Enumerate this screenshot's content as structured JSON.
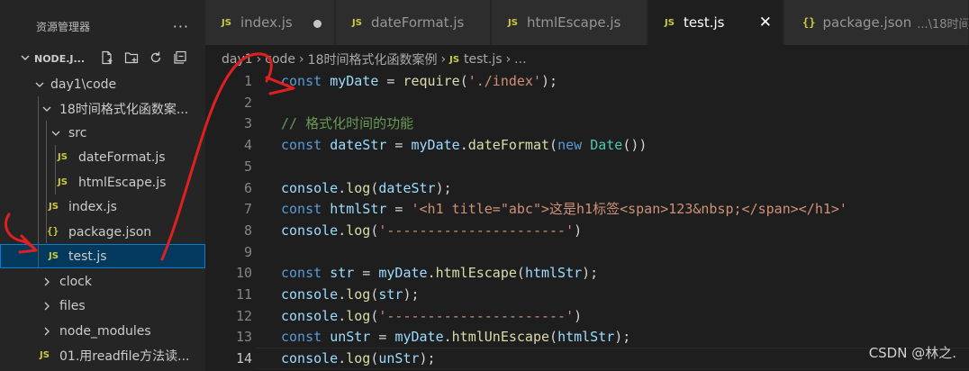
{
  "sidebar": {
    "header_title": "资源管理器",
    "more_label": "···",
    "section_title": "NODE.J...",
    "tree": [
      {
        "label": "day1\\code",
        "type": "folder-open"
      },
      {
        "label": "18时间格式化函数案...",
        "type": "folder-open"
      },
      {
        "label": "src",
        "type": "folder-open"
      },
      {
        "label": "dateFormat.js",
        "type": "js"
      },
      {
        "label": "htmlEscape.js",
        "type": "js"
      },
      {
        "label": "index.js",
        "type": "js"
      },
      {
        "label": "package.json",
        "type": "json"
      },
      {
        "label": "test.js",
        "type": "js",
        "selected": true
      },
      {
        "label": "clock",
        "type": "folder-closed"
      },
      {
        "label": "files",
        "type": "folder-closed"
      },
      {
        "label": "node_modules",
        "type": "folder-closed"
      },
      {
        "label": "01.用readfile方法读...",
        "type": "js"
      }
    ]
  },
  "tabs": [
    {
      "icon": "JS",
      "label": "index.js",
      "state": "modified"
    },
    {
      "icon": "JS",
      "label": "dateFormat.js",
      "state": ""
    },
    {
      "icon": "JS",
      "label": "htmlEscape.js",
      "state": ""
    },
    {
      "icon": "JS",
      "label": "test.js",
      "state": "active"
    },
    {
      "icon": "{}",
      "label": "package.json",
      "desc": "...\\18时间"
    }
  ],
  "tab_close_glyph": "✕",
  "breadcrumb": {
    "parts": [
      "day1",
      "code",
      "18时间格式化函数案例",
      "test.js",
      "..."
    ],
    "file_icon": "JS"
  },
  "editor": {
    "current_line": 14,
    "lines": [
      {
        "n": "1",
        "tokens": [
          [
            "kw",
            "const"
          ],
          [
            "pun",
            " "
          ],
          [
            "var",
            "myDate"
          ],
          [
            "pun",
            " = "
          ],
          [
            "fn",
            "require"
          ],
          [
            "pun",
            "("
          ],
          [
            "str",
            "'./index'"
          ],
          [
            "pun",
            ");"
          ]
        ]
      },
      {
        "n": "2",
        "tokens": []
      },
      {
        "n": "3",
        "tokens": [
          [
            "cmt",
            "// 格式化时间的功能"
          ]
        ]
      },
      {
        "n": "4",
        "tokens": [
          [
            "kw",
            "const"
          ],
          [
            "pun",
            " "
          ],
          [
            "var",
            "dateStr"
          ],
          [
            "pun",
            " = "
          ],
          [
            "var",
            "myDate"
          ],
          [
            "pun",
            "."
          ],
          [
            "fn",
            "dateFormat"
          ],
          [
            "pun",
            "("
          ],
          [
            "kw",
            "new"
          ],
          [
            "pun",
            " "
          ],
          [
            "cls",
            "Date"
          ],
          [
            "pun",
            "())"
          ]
        ]
      },
      {
        "n": "5",
        "tokens": []
      },
      {
        "n": "6",
        "tokens": [
          [
            "var",
            "console"
          ],
          [
            "pun",
            "."
          ],
          [
            "fn",
            "log"
          ],
          [
            "pun",
            "("
          ],
          [
            "var",
            "dateStr"
          ],
          [
            "pun",
            ");"
          ]
        ]
      },
      {
        "n": "7",
        "tokens": [
          [
            "kw",
            "const"
          ],
          [
            "pun",
            " "
          ],
          [
            "var",
            "htmlStr"
          ],
          [
            "pun",
            " = "
          ],
          [
            "str",
            "'<h1 title=\"abc\">这是h1标签<span>123&nbsp;</span></h1>'"
          ]
        ]
      },
      {
        "n": "8",
        "tokens": [
          [
            "var",
            "console"
          ],
          [
            "pun",
            "."
          ],
          [
            "fn",
            "log"
          ],
          [
            "pun",
            "("
          ],
          [
            "str",
            "'----------------------'"
          ],
          [
            "pun",
            ")"
          ]
        ]
      },
      {
        "n": "9",
        "tokens": []
      },
      {
        "n": "10",
        "tokens": [
          [
            "kw",
            "const"
          ],
          [
            "pun",
            " "
          ],
          [
            "var",
            "str"
          ],
          [
            "pun",
            " = "
          ],
          [
            "var",
            "myDate"
          ],
          [
            "pun",
            "."
          ],
          [
            "fn",
            "htmlEscape"
          ],
          [
            "pun",
            "("
          ],
          [
            "var",
            "htmlStr"
          ],
          [
            "pun",
            ");"
          ]
        ]
      },
      {
        "n": "11",
        "tokens": [
          [
            "var",
            "console"
          ],
          [
            "pun",
            "."
          ],
          [
            "fn",
            "log"
          ],
          [
            "pun",
            "("
          ],
          [
            "var",
            "str"
          ],
          [
            "pun",
            ");"
          ]
        ]
      },
      {
        "n": "12",
        "tokens": [
          [
            "var",
            "console"
          ],
          [
            "pun",
            "."
          ],
          [
            "fn",
            "log"
          ],
          [
            "pun",
            "("
          ],
          [
            "str",
            "'----------------------'"
          ],
          [
            "pun",
            ")"
          ]
        ]
      },
      {
        "n": "13",
        "tokens": [
          [
            "kw",
            "const"
          ],
          [
            "pun",
            " "
          ],
          [
            "var",
            "unStr"
          ],
          [
            "pun",
            " = "
          ],
          [
            "var",
            "myDate"
          ],
          [
            "pun",
            "."
          ],
          [
            "fn",
            "htmlUnEscape"
          ],
          [
            "pun",
            "("
          ],
          [
            "var",
            "htmlStr"
          ],
          [
            "pun",
            ");"
          ]
        ]
      },
      {
        "n": "14",
        "tokens": [
          [
            "var",
            "console"
          ],
          [
            "pun",
            "."
          ],
          [
            "fn",
            "log"
          ],
          [
            "pun",
            "("
          ],
          [
            "var",
            "unStr"
          ],
          [
            "pun",
            ");"
          ]
        ]
      }
    ]
  },
  "watermark": "CSDN @林之.",
  "colors": {
    "annotation": "#e02020",
    "js_icon": "#cbcb41",
    "selection": "#04395e"
  }
}
